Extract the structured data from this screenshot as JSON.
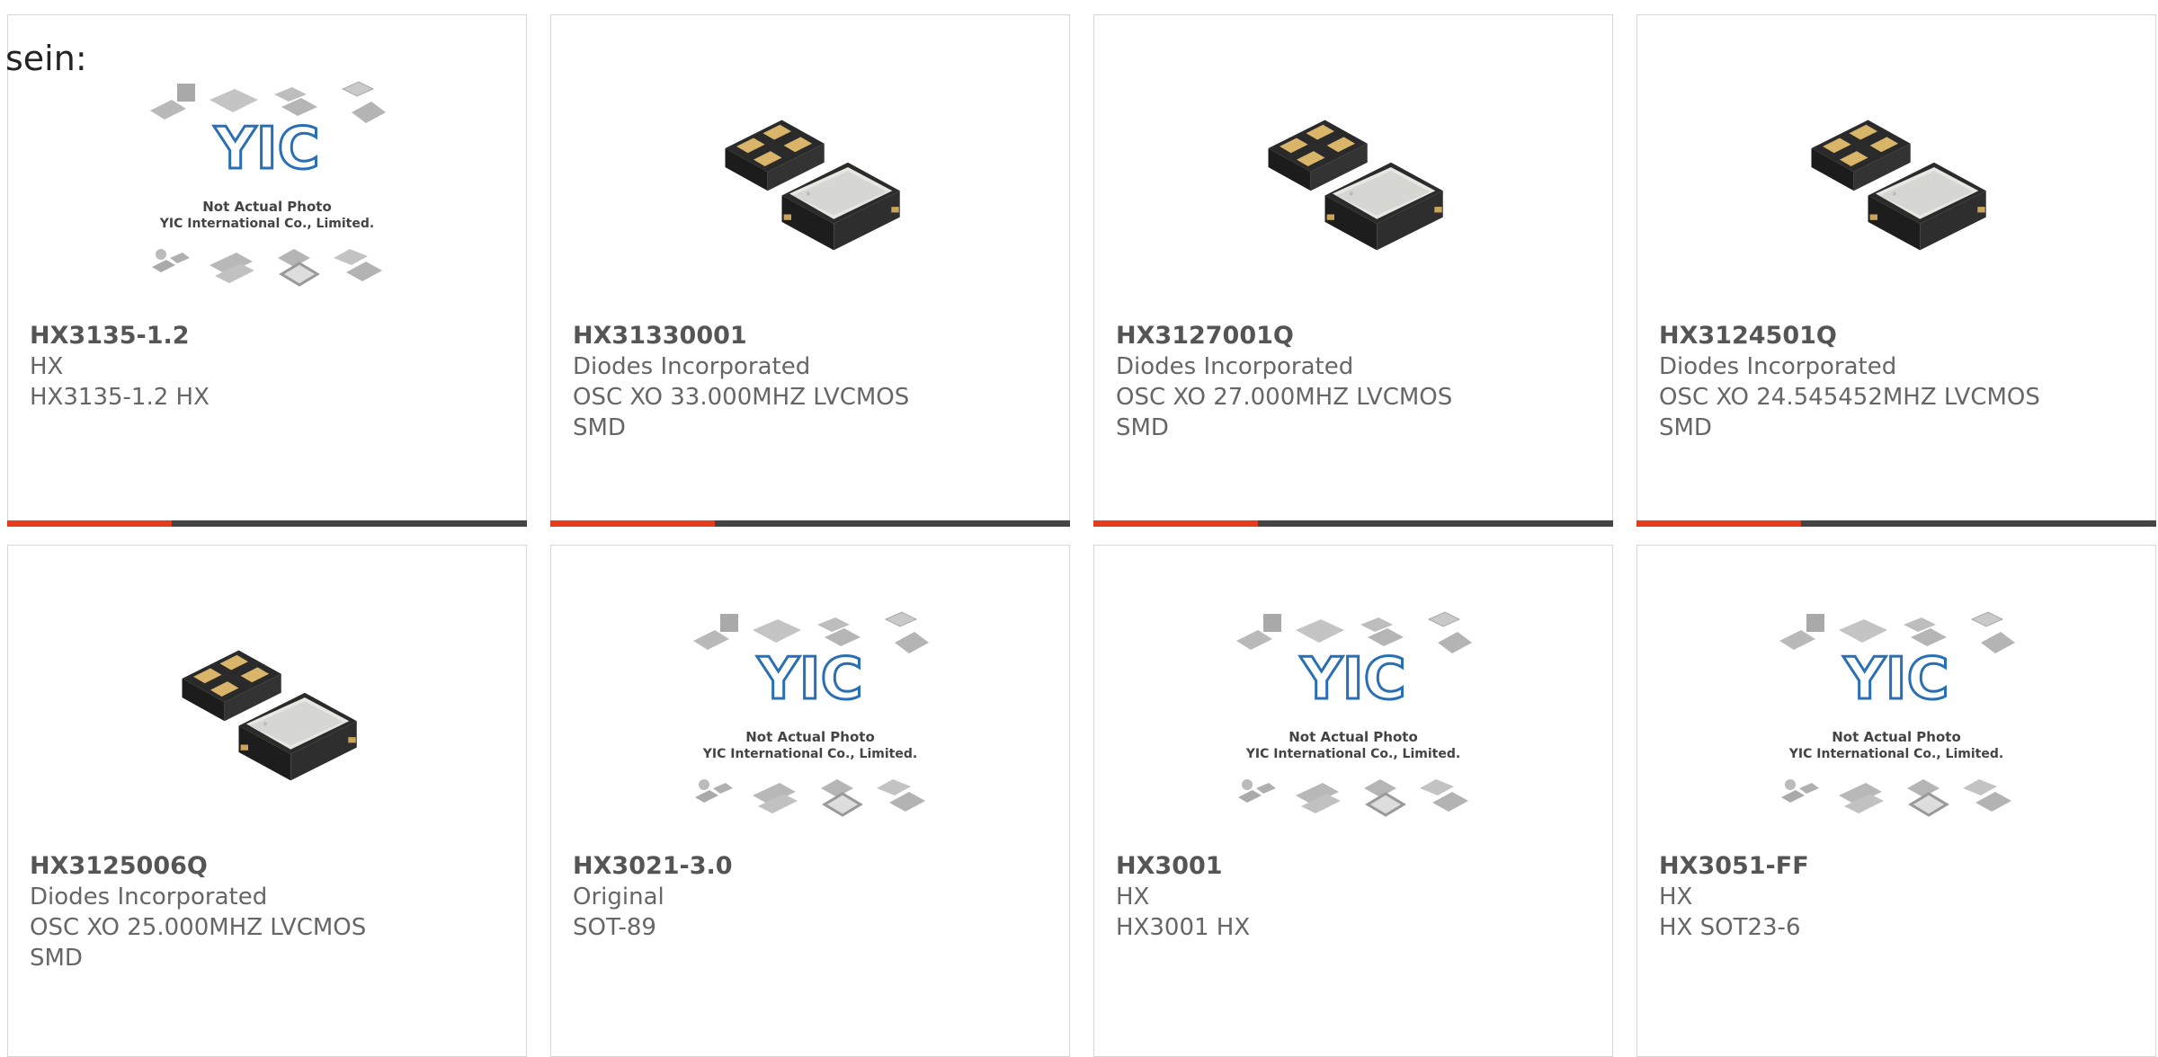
{
  "page": {
    "prefix_text": "sein:"
  },
  "products": [
    {
      "part": "HX3135-1.2",
      "lines": [
        "HX",
        "HX3135-1.2 HX"
      ],
      "image": "not-actual-photo",
      "bar": true
    },
    {
      "part": "HX31330001",
      "lines": [
        "Diodes Incorporated",
        "OSC XO 33.000MHZ LVCMOS",
        "SMD"
      ],
      "image": "smd-crystal-oscillator",
      "bar": true
    },
    {
      "part": "HX3127001Q",
      "lines": [
        "Diodes Incorporated",
        "OSC XO 27.000MHZ LVCMOS",
        "SMD"
      ],
      "image": "smd-crystal-oscillator",
      "bar": true
    },
    {
      "part": "HX3124501Q",
      "lines": [
        "Diodes Incorporated",
        "OSC XO 24.545452MHZ LVCMOS",
        "SMD"
      ],
      "image": "smd-crystal-oscillator",
      "bar": true
    },
    {
      "part": "HX3125006Q",
      "lines": [
        "Diodes Incorporated",
        "OSC XO 25.000MHZ LVCMOS",
        "SMD"
      ],
      "image": "smd-crystal-oscillator",
      "bar": false
    },
    {
      "part": "HX3021-3.0",
      "lines": [
        "Original",
        "SOT-89"
      ],
      "image": "not-actual-photo",
      "bar": false
    },
    {
      "part": "HX3001",
      "lines": [
        "HX",
        "HX3001 HX"
      ],
      "image": "not-actual-photo",
      "bar": false
    },
    {
      "part": "HX3051-FF",
      "lines": [
        "HX",
        "HX SOT23-6"
      ],
      "image": "not-actual-photo",
      "bar": false
    }
  ],
  "placeholder": {
    "logo_text": "YIC",
    "caption_line1": "Not Actual Photo",
    "caption_line2": "YIC International Co., Limited."
  },
  "colors": {
    "accent": "#e63b1c",
    "bar_dark": "#444444",
    "logo_blue": "#2a6fb5"
  }
}
